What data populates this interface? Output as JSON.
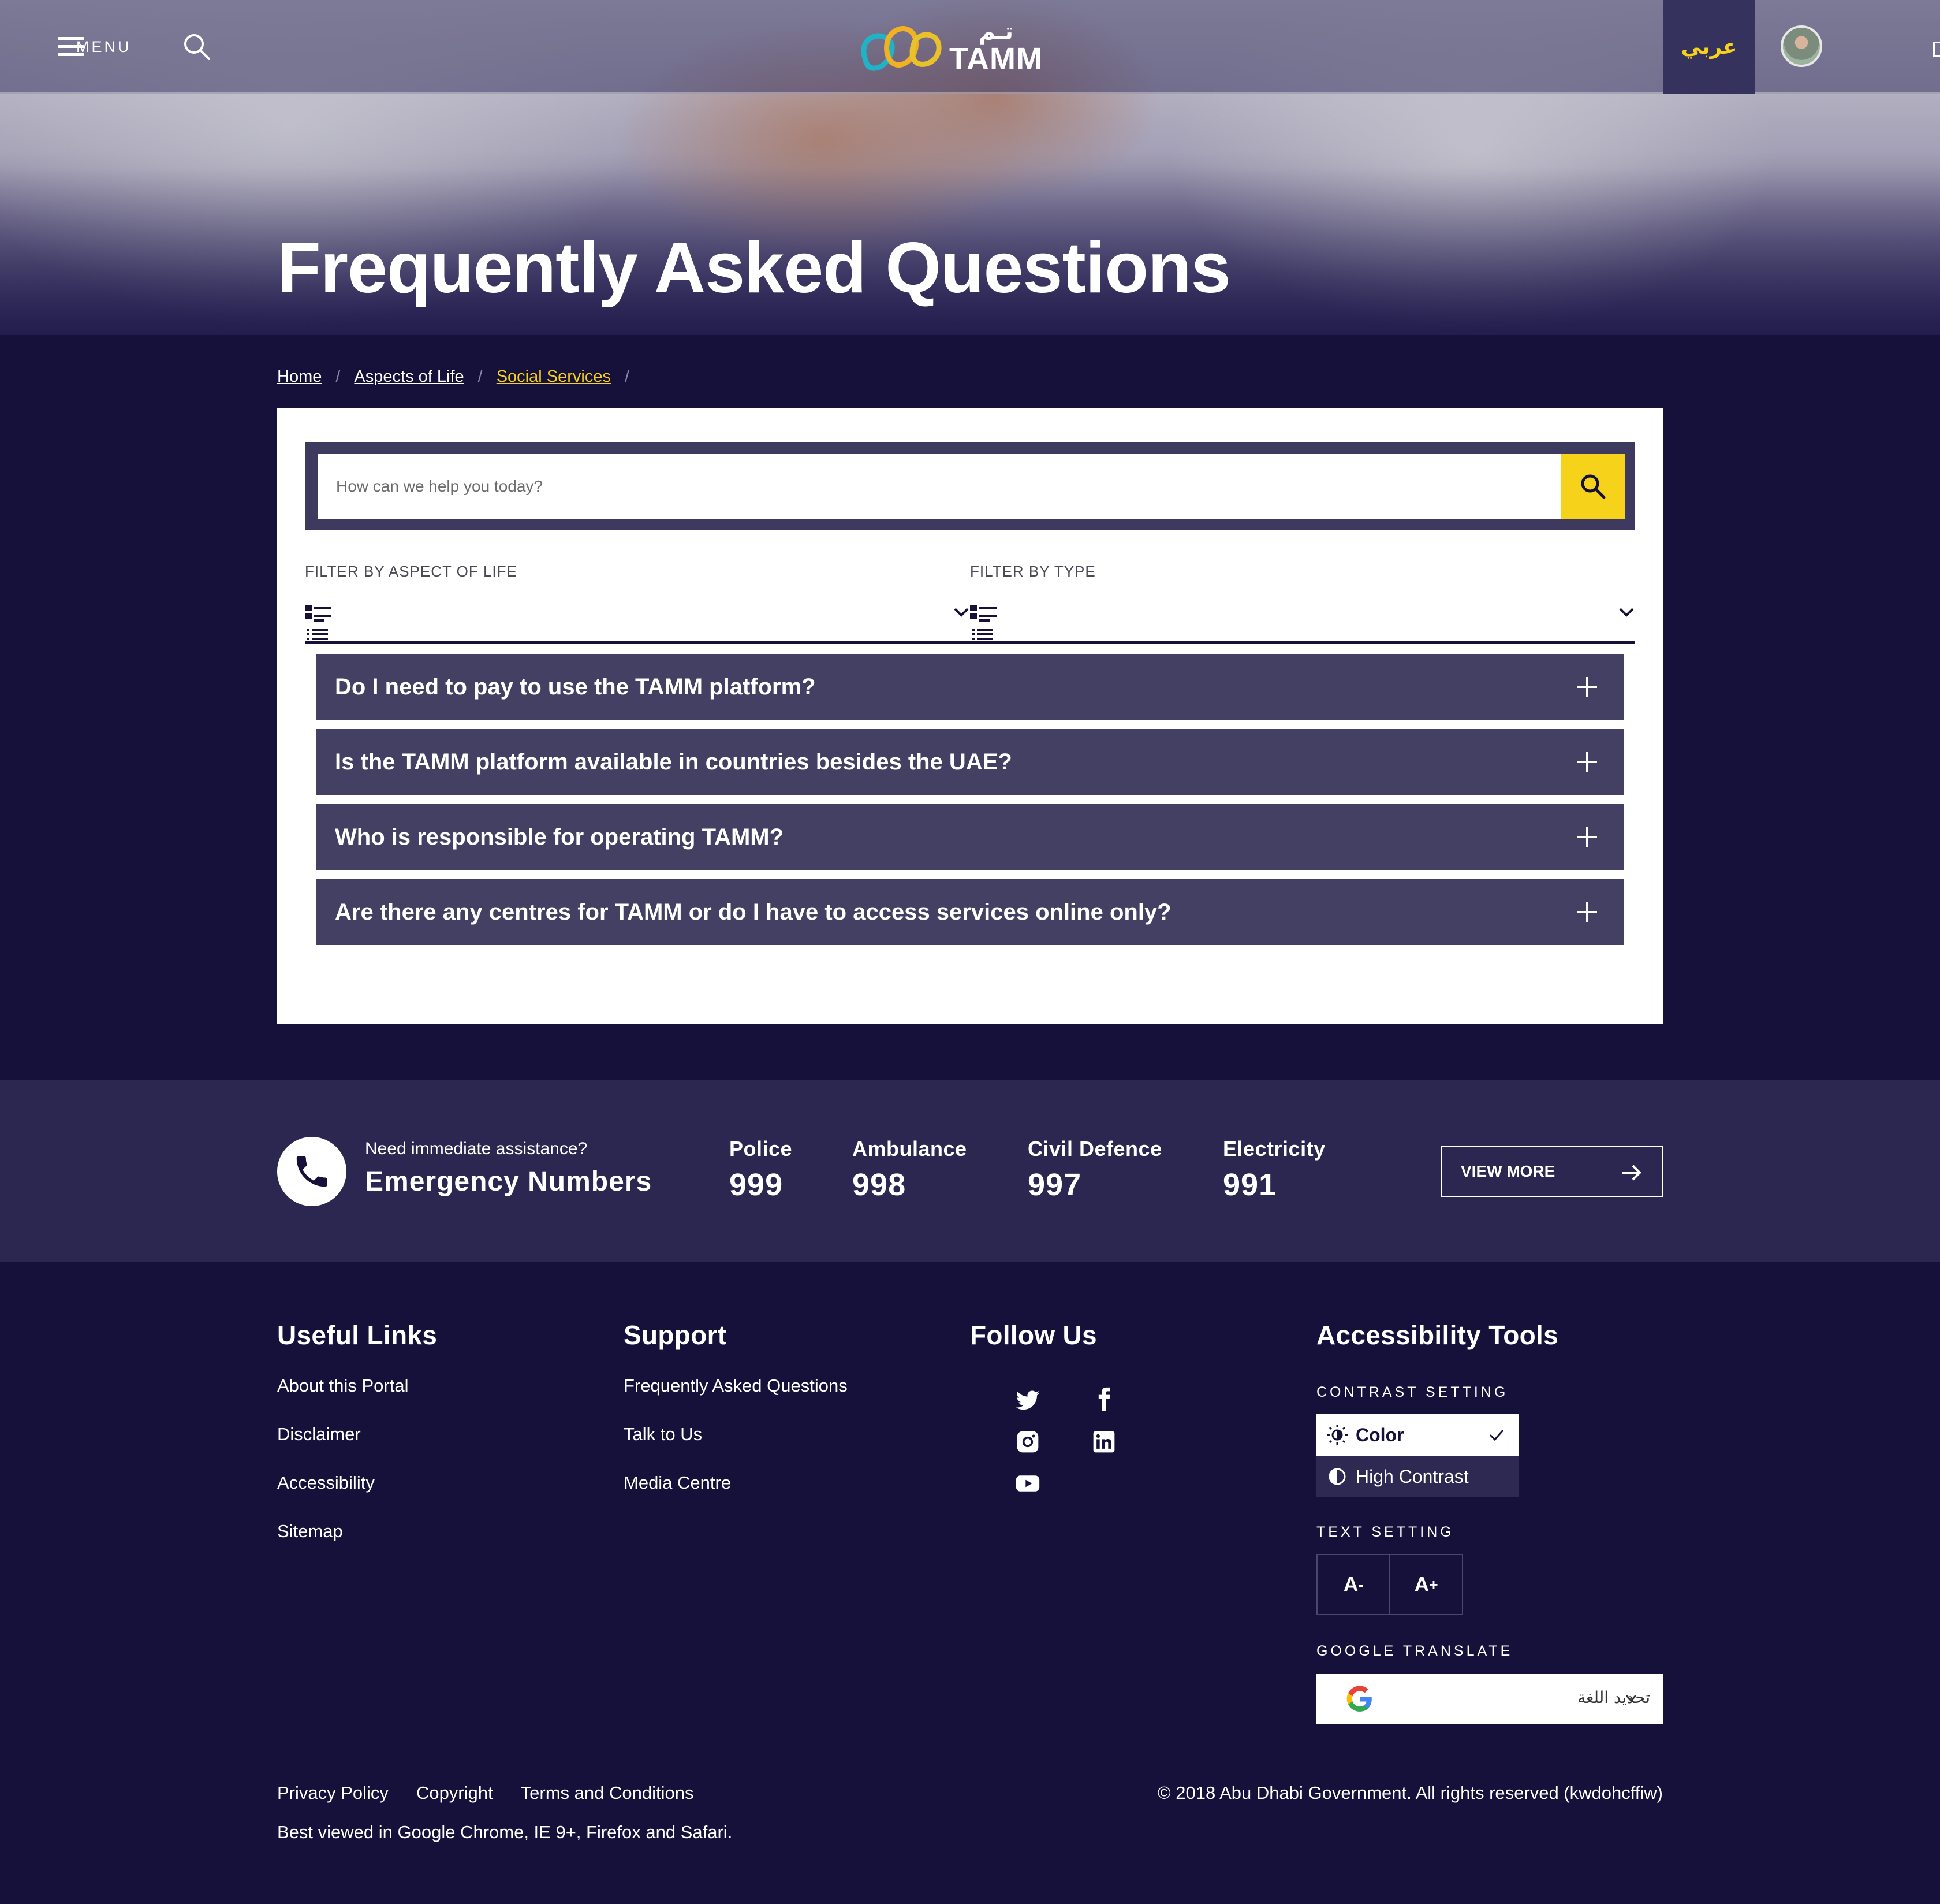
{
  "header": {
    "menu_label": "MENU",
    "logo_ar": "تـم",
    "logo_en": "TAMM",
    "lang_label": "عربي"
  },
  "hero": {
    "title": "Frequently Asked Questions"
  },
  "breadcrumb": {
    "items": [
      "Home",
      "Aspects of Life",
      "Social Services"
    ],
    "separator": "/"
  },
  "search": {
    "placeholder": "How can we help you today?"
  },
  "filters": {
    "aspect_label": "FILTER BY ASPECT OF LIFE",
    "type_label": "FILTER BY TYPE"
  },
  "faqs": [
    {
      "question": "Do I need to pay to use the TAMM platform?"
    },
    {
      "question": "Is the TAMM platform available in countries besides the UAE?"
    },
    {
      "question": "Who is responsible for operating TAMM?"
    },
    {
      "question": "Are there any centres for TAMM or do I have to access services online only?"
    }
  ],
  "emergency": {
    "subtitle": "Need immediate assistance?",
    "title": "Emergency Numbers",
    "numbers": [
      {
        "name": "Police",
        "number": "999"
      },
      {
        "name": "Ambulance",
        "number": "998"
      },
      {
        "name": "Civil Defence",
        "number": "997"
      },
      {
        "name": "Electricity",
        "number": "991"
      }
    ],
    "view_more": "VIEW MORE"
  },
  "footer": {
    "useful_links": {
      "title": "Useful Links",
      "items": [
        "About this Portal",
        "Disclaimer",
        "Accessibility",
        "Sitemap"
      ]
    },
    "support": {
      "title": "Support",
      "items": [
        "Frequently Asked Questions",
        "Talk to Us",
        "Media Centre"
      ]
    },
    "follow": {
      "title": "Follow Us",
      "icons": [
        "twitter-icon",
        "facebook-icon",
        "instagram-icon",
        "linkedin-icon",
        "youtube-icon"
      ]
    },
    "accessibility": {
      "title": "Accessibility Tools",
      "contrast_label": "CONTRAST SETTING",
      "contrast_options": [
        "Color",
        "High Contrast"
      ],
      "selected_contrast": "Color",
      "text_label": "TEXT SETTING",
      "text_decrease": "A",
      "text_decrease_sup": "-",
      "text_increase": "A",
      "text_increase_sup": "+",
      "translate_label": "GOOGLE TRANSLATE",
      "translate_text": "تحديد اللغة"
    },
    "bottom_links": [
      "Privacy Policy",
      "Copyright",
      "Terms and Conditions"
    ],
    "best_viewed": "Best viewed in Google Chrome, IE 9+, Firefox and Safari.",
    "copyright": "© 2018 Abu Dhabi Government. All rights reserved (kwdohcffiw)"
  },
  "colors": {
    "background": "#16113a",
    "accent": "#f6d21a",
    "panel": "#434063",
    "emergency_band": "#2b2751"
  }
}
